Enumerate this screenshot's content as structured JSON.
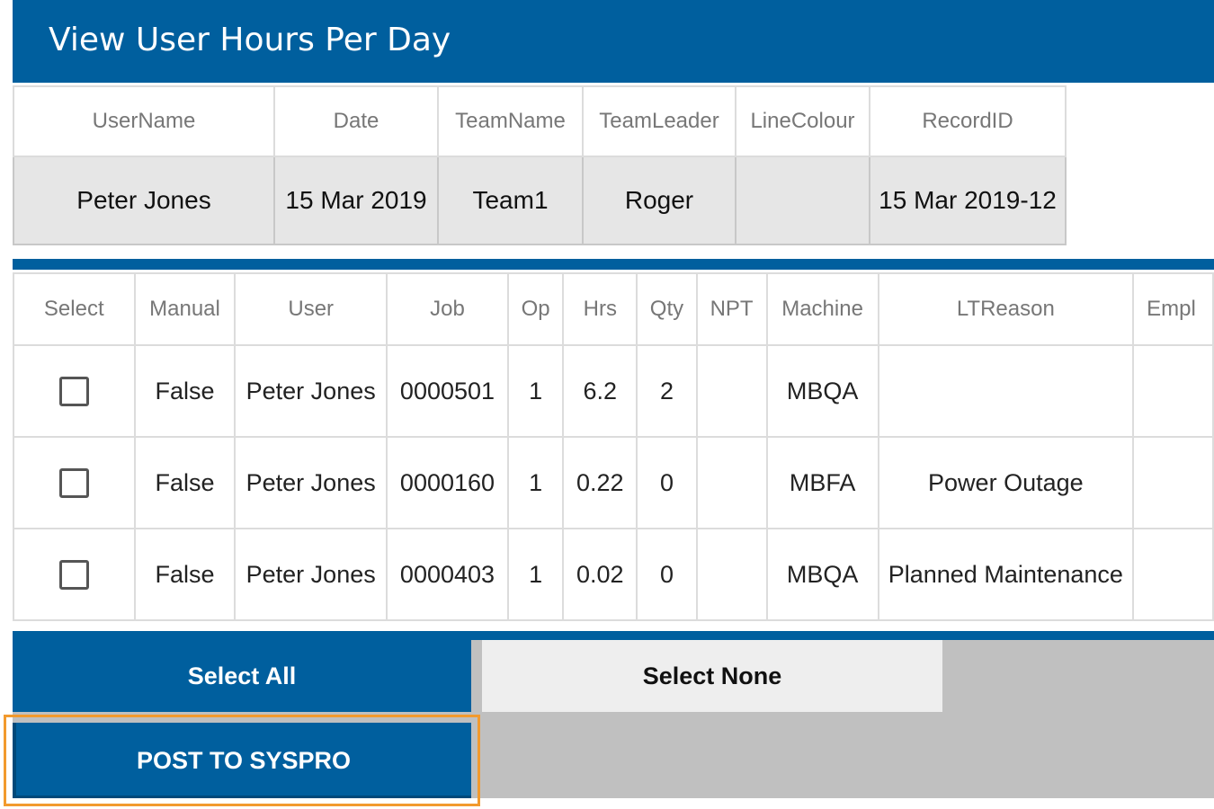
{
  "window": {
    "title": "View User Hours Per Day"
  },
  "info_table": {
    "headers": [
      "UserName",
      "Date",
      "TeamName",
      "TeamLeader",
      "LineColour",
      "RecordID"
    ],
    "values": [
      "Peter Jones",
      "15 Mar 2019",
      "Team1",
      "Roger",
      "",
      "15 Mar 2019-12"
    ]
  },
  "detail_table": {
    "headers": [
      "Select",
      "Manual",
      "User",
      "Job",
      "Op",
      "Hrs",
      "Qty",
      "NPT",
      "Machine",
      "LTReason",
      "Empl"
    ],
    "rows": [
      {
        "selected": false,
        "manual": "False",
        "user": "Peter Jones",
        "job": "0000501",
        "op": "1",
        "hrs": "6.2",
        "qty": "2",
        "npt": "",
        "machine": "MBQA",
        "ltreason": "",
        "empl": ""
      },
      {
        "selected": false,
        "manual": "False",
        "user": "Peter Jones",
        "job": "0000160",
        "op": "1",
        "hrs": "0.22",
        "qty": "0",
        "npt": "",
        "machine": "MBFA",
        "ltreason": "Power Outage",
        "empl": ""
      },
      {
        "selected": false,
        "manual": "False",
        "user": "Peter Jones",
        "job": "0000403",
        "op": "1",
        "hrs": "0.02",
        "qty": "0",
        "npt": "",
        "machine": "MBQA",
        "ltreason": "Planned Maintenance",
        "empl": ""
      }
    ]
  },
  "actions": {
    "select_all": "Select All",
    "select_none": "Select None",
    "post": "POST TO SYSPRO"
  },
  "colors": {
    "brand_blue": "#005f9e",
    "highlight_orange": "#f29a2e"
  }
}
